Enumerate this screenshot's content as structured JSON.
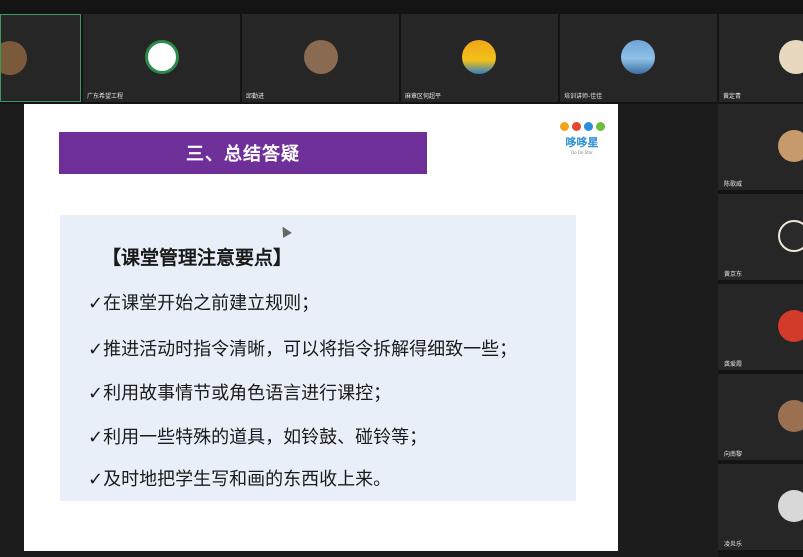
{
  "participants_top": [
    {
      "name": ""
    },
    {
      "name": "广东希望工程"
    },
    {
      "name": "邱勤进"
    },
    {
      "name": "麻章区何超平"
    },
    {
      "name": "培训讲师-佳佳"
    },
    {
      "name": "黄定青"
    }
  ],
  "participants_side": [
    {
      "name": "陈歌威"
    },
    {
      "name": "黄京东"
    },
    {
      "name": "龚爱霞"
    },
    {
      "name": "向南黎"
    },
    {
      "name": "凌炎乐"
    }
  ],
  "slide": {
    "title": "三、总结答疑",
    "logo_text": "哆哆星",
    "logo_sub": "Do Do Star",
    "heading": "【课堂管理注意要点】",
    "items": [
      "✓在课堂开始之前建立规则；",
      "✓推进活动时指令清晰，可以将指令拆解得细致一些；",
      "✓利用故事情节或角色语言进行课控；",
      "✓利用一些特殊的道具，如铃鼓、碰铃等；",
      "✓及时地把学生写和画的东西收上来。"
    ]
  },
  "colors": {
    "title_bar": "#6f2f99",
    "content_box": "#e8eff8",
    "logo_blue": "#2b8fd6"
  }
}
